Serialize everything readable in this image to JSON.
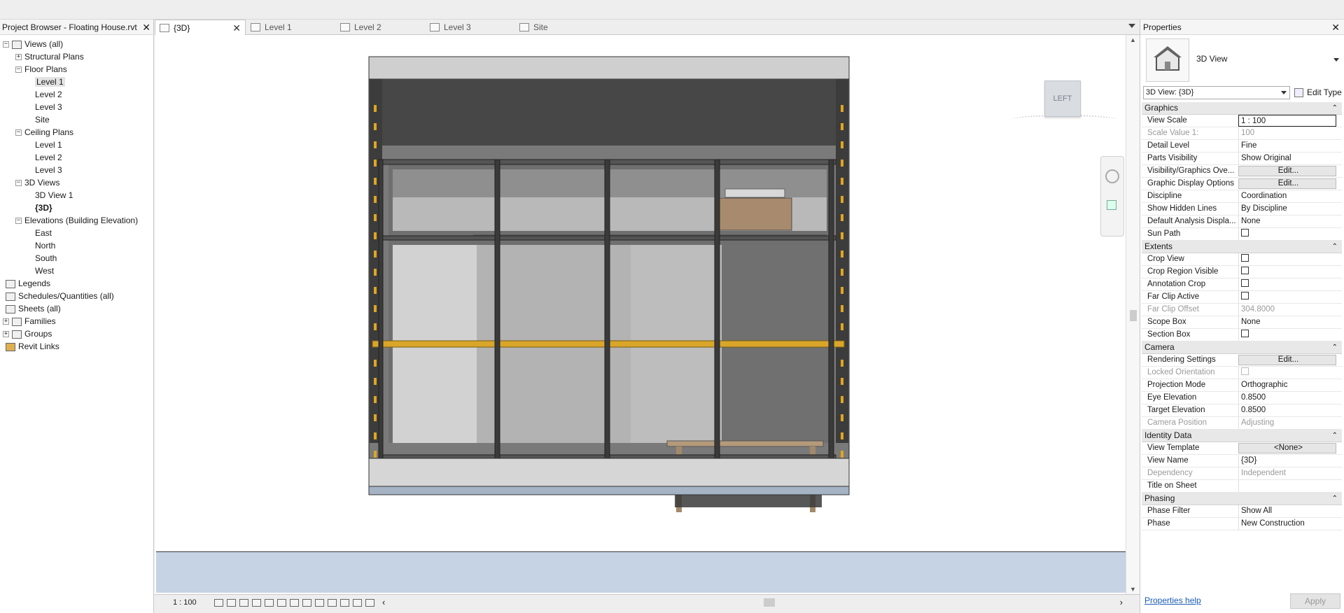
{
  "project_browser": {
    "title": "Project Browser - Floating House.rvt",
    "tree": [
      {
        "label": "Views (all)",
        "toggle": "−"
      },
      {
        "label": "Structural Plans",
        "toggle": "+"
      },
      {
        "label": "Floor Plans",
        "toggle": "−"
      },
      {
        "label": "Level 1",
        "selected": true
      },
      {
        "label": "Level 2"
      },
      {
        "label": "Level 3"
      },
      {
        "label": "Site"
      },
      {
        "label": "Ceiling Plans",
        "toggle": "−"
      },
      {
        "label": "Level 1"
      },
      {
        "label": "Level 2"
      },
      {
        "label": "Level 3"
      },
      {
        "label": "3D Views",
        "toggle": "−"
      },
      {
        "label": "3D View 1"
      },
      {
        "label": "{3D}",
        "bold": true
      },
      {
        "label": "Elevations (Building Elevation)",
        "toggle": "−"
      },
      {
        "label": "East"
      },
      {
        "label": "North"
      },
      {
        "label": "South"
      },
      {
        "label": "West"
      },
      {
        "label": "Legends"
      },
      {
        "label": "Schedules/Quantities (all)"
      },
      {
        "label": "Sheets (all)"
      },
      {
        "label": "Families",
        "toggle": "+"
      },
      {
        "label": "Groups",
        "toggle": "+"
      },
      {
        "label": "Revit Links"
      }
    ]
  },
  "tabs": [
    {
      "label": "{3D}",
      "active": true
    },
    {
      "label": "Level 1"
    },
    {
      "label": "Level 2"
    },
    {
      "label": "Level 3"
    },
    {
      "label": "Site"
    }
  ],
  "viewcube": {
    "face": "LEFT"
  },
  "view_control_bar": {
    "scale": "1 : 100"
  },
  "properties": {
    "title": "Properties",
    "type_name": "3D View",
    "view_selector": "3D View: {3D}",
    "edit_type": "Edit Type",
    "sections": [
      {
        "name": "Graphics",
        "rows": [
          {
            "name": "View Scale",
            "value": "1 : 100",
            "boxed": true
          },
          {
            "name": "Scale Value    1:",
            "value": "100",
            "disabled": true
          },
          {
            "name": "Detail Level",
            "value": "Fine"
          },
          {
            "name": "Parts Visibility",
            "value": "Show Original"
          },
          {
            "name": "Visibility/Graphics Ove...",
            "value": "Edit...",
            "button": true
          },
          {
            "name": "Graphic Display Options",
            "value": "Edit...",
            "button": true
          },
          {
            "name": "Discipline",
            "value": "Coordination"
          },
          {
            "name": "Show Hidden Lines",
            "value": "By Discipline"
          },
          {
            "name": "Default Analysis Displa...",
            "value": "None"
          },
          {
            "name": "Sun Path",
            "value": "",
            "checkbox": true
          }
        ]
      },
      {
        "name": "Extents",
        "rows": [
          {
            "name": "Crop View",
            "value": "",
            "checkbox": true
          },
          {
            "name": "Crop Region Visible",
            "value": "",
            "checkbox": true
          },
          {
            "name": "Annotation Crop",
            "value": "",
            "checkbox": true
          },
          {
            "name": "Far Clip Active",
            "value": "",
            "checkbox": true
          },
          {
            "name": "Far Clip Offset",
            "value": "304.8000",
            "disabled": true
          },
          {
            "name": "Scope Box",
            "value": "None"
          },
          {
            "name": "Section Box",
            "value": "",
            "checkbox": true
          }
        ]
      },
      {
        "name": "Camera",
        "rows": [
          {
            "name": "Rendering Settings",
            "value": "Edit...",
            "button": true
          },
          {
            "name": "Locked Orientation",
            "value": "",
            "checkbox": true,
            "disabled": true
          },
          {
            "name": "Projection Mode",
            "value": "Orthographic"
          },
          {
            "name": "Eye Elevation",
            "value": "0.8500"
          },
          {
            "name": "Target Elevation",
            "value": "0.8500"
          },
          {
            "name": "Camera Position",
            "value": "Adjusting",
            "disabled": true
          }
        ]
      },
      {
        "name": "Identity Data",
        "rows": [
          {
            "name": "View Template",
            "value": "<None>",
            "button": true
          },
          {
            "name": "View Name",
            "value": "{3D}"
          },
          {
            "name": "Dependency",
            "value": "Independent",
            "disabled": true
          },
          {
            "name": "Title on Sheet",
            "value": ""
          }
        ]
      },
      {
        "name": "Phasing",
        "rows": [
          {
            "name": "Phase Filter",
            "value": "Show All"
          },
          {
            "name": "Phase",
            "value": "New Construction"
          }
        ]
      }
    ],
    "help_link": "Properties help",
    "apply": "Apply"
  },
  "colors": {
    "accent_beam": "#d9a62a",
    "building_dark": "#474747",
    "ground": "#c5d3e4"
  }
}
